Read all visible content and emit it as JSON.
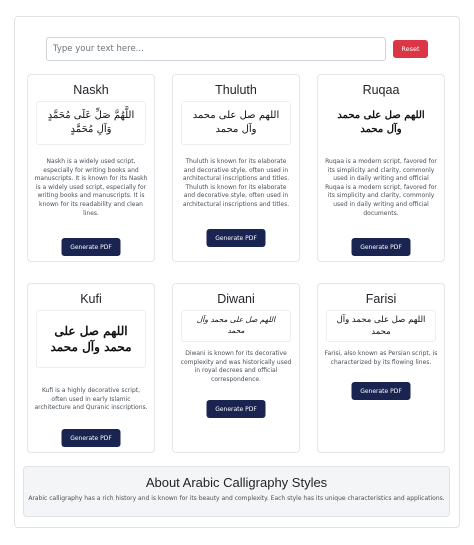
{
  "input": {
    "placeholder": "Type your text here...",
    "value": ""
  },
  "reset_label": "Reset",
  "colors": {
    "reset": "#dc3545",
    "pdf_button": "#1a2450",
    "about_bg": "#f4f5f7"
  },
  "cards": [
    {
      "title": "Naskh",
      "sample": "اللَّهُمَّ صَلِّ عَلَى مُحَمَّدٍ وَآلِ مُحَمَّدٍ",
      "description": "Naskh is a widely used script, especially for writing books and manuscripts. It is known for its Naskh is a widely used script, especially for writing books and manuscripts. It is known for its readability and clean lines.",
      "button": "Generate PDF"
    },
    {
      "title": "Thuluth",
      "sample": "اللهم صل على محمد وآل محمد",
      "description": "Thuluth is known for its elaborate and decorative style, often used in architectural inscriptions and titles. Thuluth is known for its elaborate and decorative style, often used in architectural inscriptions and titles.",
      "button": "Generate PDF"
    },
    {
      "title": "Ruqaa",
      "sample": "اللهم صل على محمد وآل محمد",
      "description": "Ruqaa is a modern script, favored for its simplicity and clarity, commonly used in daily writing and official Ruqaa is a modern script, favored for its simplicity and clarity, commonly used in daily writing and official documents.",
      "button": "Generate PDF"
    },
    {
      "title": "Kufi",
      "sample": "اللهم صل على محمد وآل محمد",
      "description": "Kufi is a highly decorative script, often used in early Islamic architecture and Quranic inscriptions.",
      "button": "Generate PDF"
    },
    {
      "title": "Diwani",
      "sample": "اللهم صل على محمد وآل محمد",
      "description": "Diwani is known for its decorative complexity and was historically used in royal decrees and official correspondence.",
      "button": "Generate PDF"
    },
    {
      "title": "Farisi",
      "sample": "اللهم صل على محمد وآل محمد",
      "description": "Farisi, also known as Persian script, is characterized by its flowing lines.",
      "button": "Generate PDF"
    }
  ],
  "about": {
    "title": "About Arabic Calligraphy Styles",
    "text": "Arabic calligraphy has a rich history and is known for its beauty and complexity. Each style has its unique characteristics and applications."
  }
}
